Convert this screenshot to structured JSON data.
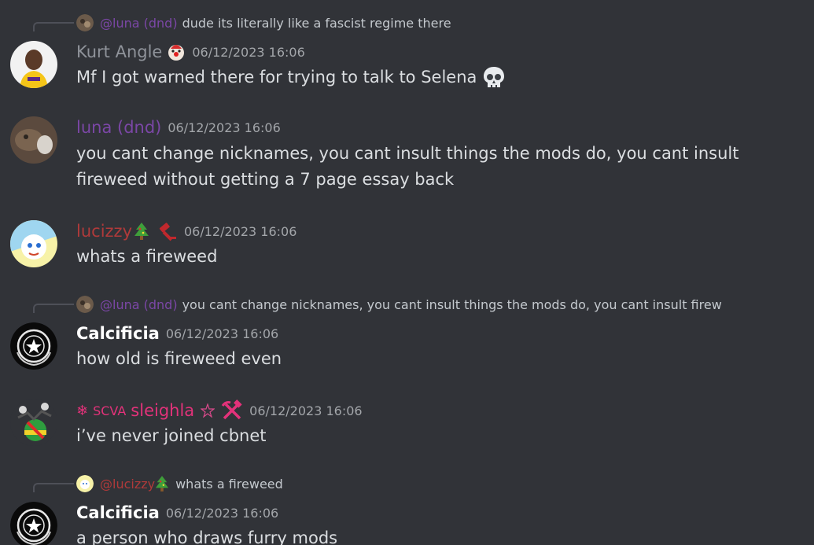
{
  "colors": {
    "background": "#313338",
    "text": "#dbdee1",
    "timestamp": "#a3a6aa",
    "kurt": "#8f939a",
    "luna": "#7b47a6",
    "lucizzy": "#b03a3a",
    "calcificia": "#ffffff",
    "sleighla": "#e3327a"
  },
  "messages": [
    {
      "reply": {
        "author": "@luna (dnd)",
        "text": "dude its literally like a fascist regime there"
      },
      "author": "Kurt Angle",
      "timestamp": "06/12/2023 16:06",
      "text": "Mf I got warned there for trying to talk to Selena",
      "emoji": "skull-icon"
    },
    {
      "author": "luna (dnd)",
      "timestamp": "06/12/2023 16:06",
      "text": "you cant change nicknames, you cant insult things the mods do, you cant insult fireweed without getting a 7 page essay back"
    },
    {
      "author": "lucizzy",
      "timestamp": "06/12/2023 16:06",
      "text": "whats a fireweed"
    },
    {
      "reply": {
        "author": "@luna (dnd)",
        "text": "you cant change nicknames, you cant insult things the mods do, you cant insult firew"
      },
      "author": "Calcificia",
      "timestamp": "06/12/2023 16:06",
      "text": "how old is fireweed even"
    },
    {
      "author_prefix": "❄",
      "author_tag": "SCVA",
      "author": "sleighla",
      "timestamp": "06/12/2023 16:06",
      "text": "i’ve never joined cbnet"
    },
    {
      "reply": {
        "author": "@lucizzy",
        "text": "whats a fireweed"
      },
      "author": "Calcificia",
      "timestamp": "06/12/2023 16:06",
      "text": "a person who draws furry mods"
    }
  ]
}
